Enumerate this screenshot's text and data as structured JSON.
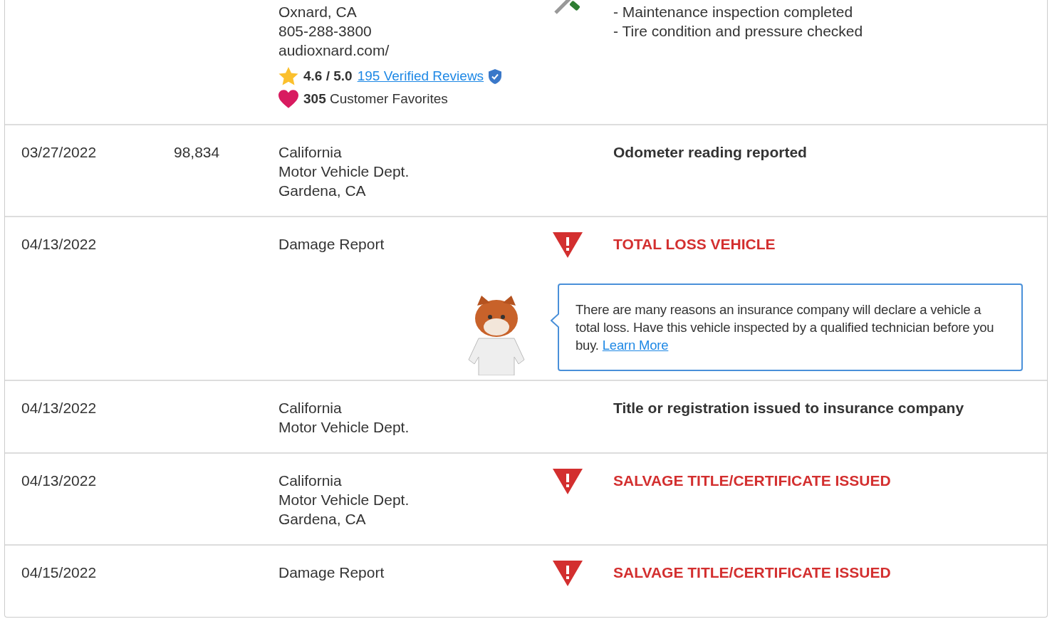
{
  "rows": [
    {
      "kind": "service",
      "source": [
        "Oxnard, CA",
        "805-288-3800",
        "audioxnard.com/"
      ],
      "lines": [
        "- Maintenance inspection completed",
        "- Tire condition and pressure checked"
      ],
      "rating": {
        "score": "4.6 / 5.0",
        "reviews_link": "195 Verified Reviews",
        "verified": true
      },
      "favorites": "**305** Customer Favorites"
    },
    {
      "kind": "note",
      "date": "03/27/2022",
      "odometer": "98,834",
      "source": [
        "California",
        "Motor Vehicle Dept.",
        "Gardena, CA"
      ],
      "title": "Odometer reading reported"
    },
    {
      "kind": "alert",
      "date": "04/13/2022",
      "source": [
        "Damage Report"
      ],
      "title": "TOTAL LOSS VEHICLE",
      "callout": {
        "text": "There are many reasons an insurance company will declare a vehicle a total loss. Have this vehicle inspected by a qualified technician before you buy.",
        "link": "Learn More"
      }
    },
    {
      "kind": "note",
      "date": "04/13/2022",
      "source": [
        "California",
        "Motor Vehicle Dept."
      ],
      "title": "Title or registration issued to insurance company"
    },
    {
      "kind": "alert",
      "date": "04/13/2022",
      "source": [
        "California",
        "Motor Vehicle Dept.",
        "Gardena, CA"
      ],
      "title": "SALVAGE TITLE/CERTIFICATE ISSUED"
    },
    {
      "kind": "alert",
      "date": "04/15/2022",
      "source": [
        "Damage Report"
      ],
      "title": "SALVAGE TITLE/CERTIFICATE ISSUED"
    }
  ]
}
